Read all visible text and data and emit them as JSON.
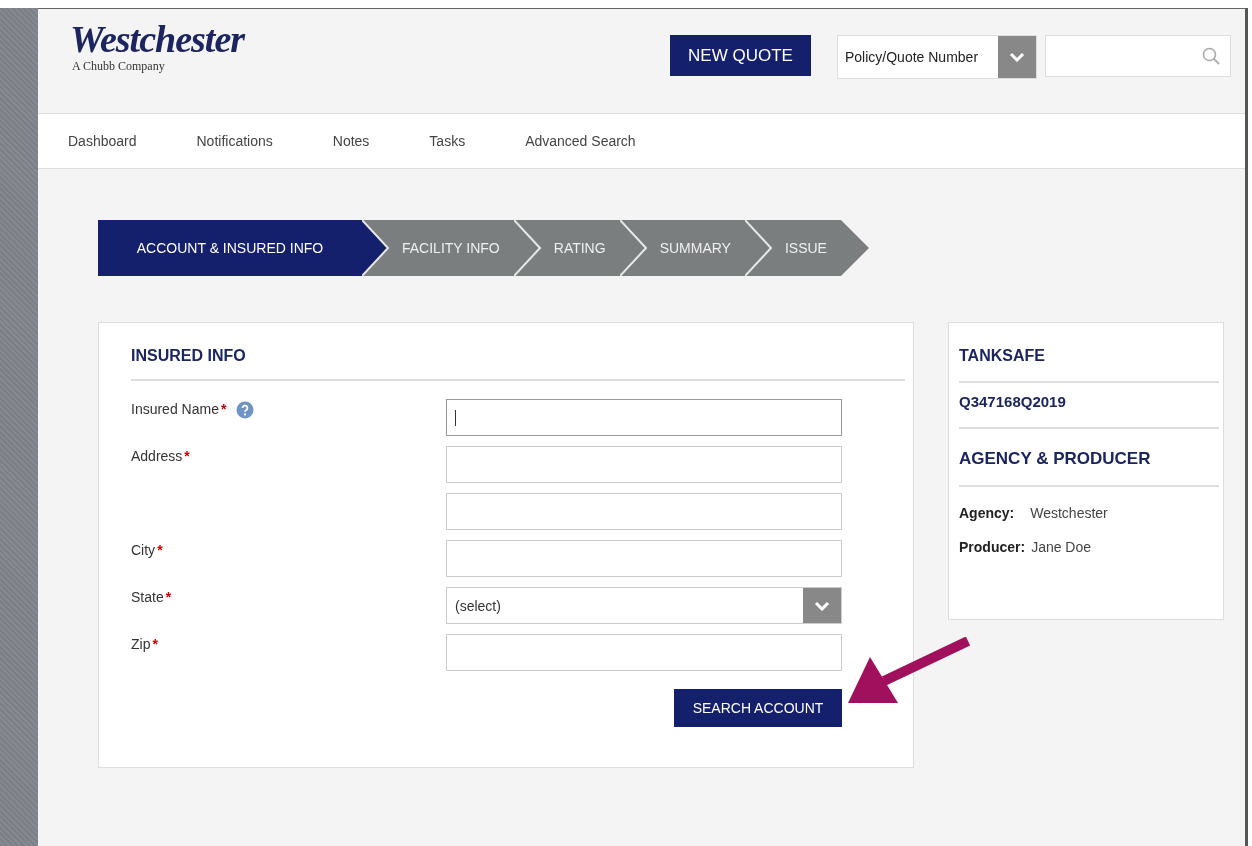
{
  "header": {
    "logo": {
      "name": "Westchester",
      "tagline": "A Chubb Company"
    },
    "new_quote_button": "NEW QUOTE",
    "search_type": {
      "value": "Policy/Quote Number"
    }
  },
  "nav": [
    {
      "label": "Dashboard"
    },
    {
      "label": "Notifications"
    },
    {
      "label": "Notes"
    },
    {
      "label": "Tasks"
    },
    {
      "label": "Advanced Search"
    }
  ],
  "steps": [
    {
      "label": "ACCOUNT & INSURED INFO",
      "selected": true
    },
    {
      "label": "FACILITY INFO",
      "selected": false
    },
    {
      "label": "RATING",
      "selected": false
    },
    {
      "label": "SUMMARY",
      "selected": false
    },
    {
      "label": "ISSUE",
      "selected": false
    }
  ],
  "insured_info": {
    "title": "INSURED INFO",
    "fields": [
      {
        "kind": "text",
        "label": "Insured Name",
        "required_mark": "*",
        "help": true,
        "focused": true
      },
      {
        "kind": "text",
        "label": "Address",
        "required_mark": "*",
        "help": false,
        "focused": false
      },
      {
        "kind": "text",
        "help": false,
        "focused": false
      },
      {
        "kind": "text",
        "label": "City",
        "required_mark": "*",
        "help": false,
        "focused": false
      },
      {
        "kind": "select",
        "label": "State",
        "required_mark": "*",
        "value": "(select)",
        "help": false,
        "focused": false
      },
      {
        "kind": "text",
        "label": "Zip",
        "required_mark": "*",
        "help": false,
        "focused": false
      }
    ],
    "search_button": "SEARCH ACCOUNT"
  },
  "sidebar": {
    "product": "TANKSAFE",
    "quote_number": "Q347168Q2019",
    "section_title": "AGENCY & PRODUCER",
    "details": [
      {
        "label": "Agency:",
        "value": "Westchester"
      },
      {
        "label": "Producer:",
        "value": "Jane Doe"
      }
    ]
  }
}
